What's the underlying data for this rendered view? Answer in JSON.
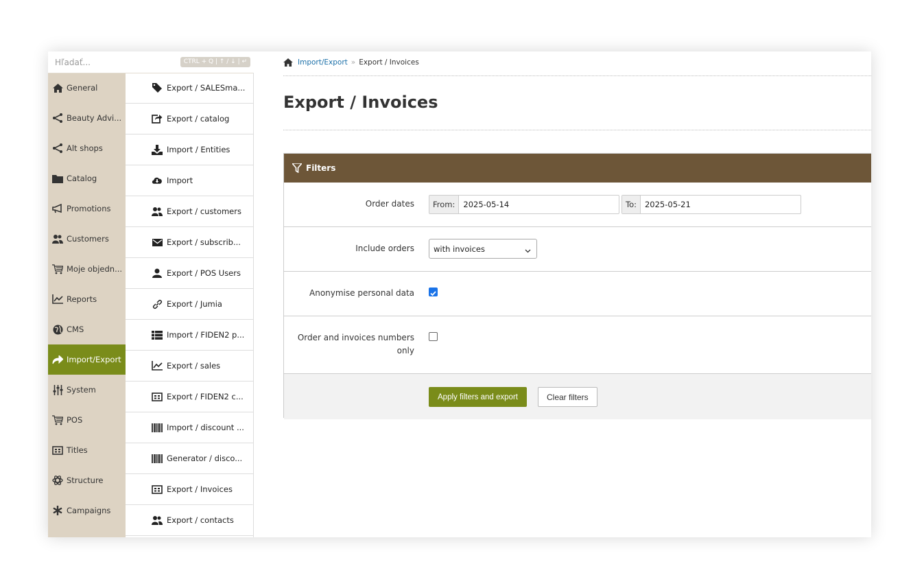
{
  "search": {
    "placeholder": "Hľadať...",
    "hint": "CTRL + Q | ↑ / ↓ | ↵"
  },
  "nav1": [
    {
      "label": "General",
      "icon": "home-icon"
    },
    {
      "label": "Beauty Advi...",
      "icon": "share-icon"
    },
    {
      "label": "Alt shops",
      "icon": "share-icon"
    },
    {
      "label": "Catalog",
      "icon": "folder-icon"
    },
    {
      "label": "Promotions",
      "icon": "bullhorn-icon"
    },
    {
      "label": "Customers",
      "icon": "users-icon"
    },
    {
      "label": "Moje objedn...",
      "icon": "cart-icon"
    },
    {
      "label": "Reports",
      "icon": "chart-icon"
    },
    {
      "label": "CMS",
      "icon": "globe-icon"
    },
    {
      "label": "Import/Export",
      "icon": "export-arrow-icon",
      "active": true
    },
    {
      "label": "System",
      "icon": "sliders-icon"
    },
    {
      "label": "POS",
      "icon": "cart-icon"
    },
    {
      "label": "Titles",
      "icon": "id-card-icon"
    },
    {
      "label": "Structure",
      "icon": "atom-icon"
    },
    {
      "label": "Campaigns",
      "icon": "asterisk-icon"
    }
  ],
  "nav2": [
    {
      "label": "Export / SALESma...",
      "icon": "tag-icon"
    },
    {
      "label": "Export / catalog",
      "icon": "external-link-icon"
    },
    {
      "label": "Import / Entities",
      "icon": "download-icon"
    },
    {
      "label": "Import",
      "icon": "cloud-download-icon"
    },
    {
      "label": "Export / customers",
      "icon": "users-icon"
    },
    {
      "label": "Export / subscrib...",
      "icon": "envelope-icon"
    },
    {
      "label": "Export / POS Users",
      "icon": "user-icon"
    },
    {
      "label": "Export / Jumia",
      "icon": "link-icon"
    },
    {
      "label": "Import / FIDEN2 p...",
      "icon": "list-icon"
    },
    {
      "label": "Export / sales",
      "icon": "chart-icon"
    },
    {
      "label": "Export / FIDEN2 c...",
      "icon": "id-card-icon"
    },
    {
      "label": "Import / discount ...",
      "icon": "barcode-icon"
    },
    {
      "label": "Generator / disco...",
      "icon": "barcode-icon"
    },
    {
      "label": "Export / Invoices",
      "icon": "id-card-icon",
      "active": true
    },
    {
      "label": "Export / contacts",
      "icon": "users-icon"
    }
  ],
  "breadcrumb": {
    "link": "Import/Export",
    "separator": "»",
    "current": "Export / Invoices"
  },
  "page_title": "Export / Invoices",
  "filters": {
    "header": "Filters",
    "order_dates_label": "Order dates",
    "from_label": "From:",
    "from_value": "2025-05-14",
    "to_label": "To:",
    "to_value": "2025-05-21",
    "include_orders_label": "Include orders",
    "include_orders_value": "with invoices",
    "anonymise_label": "Anonymise personal data",
    "anonymise_checked": true,
    "numbers_only_label": "Order and invoices numbers only",
    "numbers_only_checked": false,
    "apply_button": "Apply filters and export",
    "clear_button": "Clear filters"
  },
  "colors": {
    "accent": "#7a8c1a",
    "panel_header": "#6d5638",
    "nav_bg": "#ddd3c3",
    "link": "#1a6fa8",
    "checkbox": "#1a73e8"
  }
}
